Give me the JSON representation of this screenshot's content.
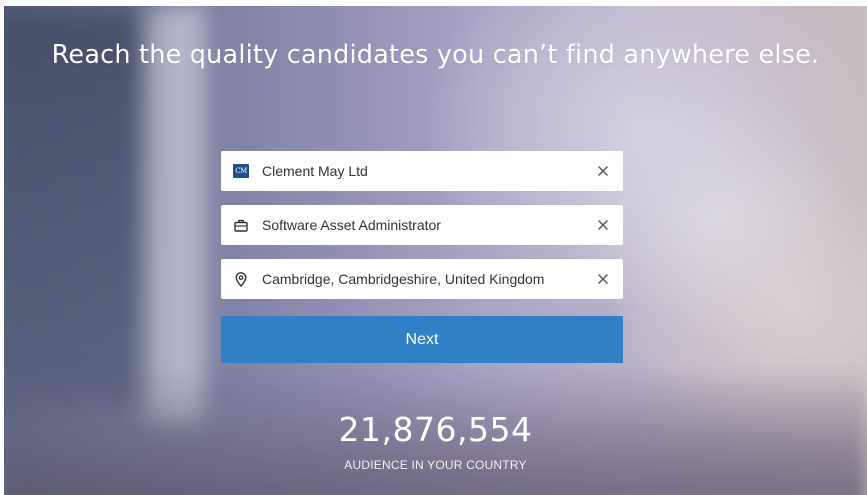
{
  "hero": {
    "headline": "Reach the quality candidates you can’t find anywhere else."
  },
  "form": {
    "company": {
      "value": "Clement May Ltd",
      "logo_text": "CM",
      "icon": "company-logo-icon",
      "clear_icon": "close-icon"
    },
    "job_title": {
      "value": "Software Asset Administrator",
      "icon": "briefcase-icon",
      "clear_icon": "close-icon"
    },
    "location": {
      "value": "Cambridge, Cambridgeshire, United Kingdom",
      "icon": "map-pin-icon",
      "clear_icon": "close-icon"
    },
    "next_label": "Next"
  },
  "audience": {
    "count": "21,876,554",
    "label": "AUDIENCE IN YOUR COUNTRY"
  },
  "colors": {
    "button": "#2f80c4",
    "company_logo": "#1e4f8f",
    "text_light": "#ffffff"
  }
}
